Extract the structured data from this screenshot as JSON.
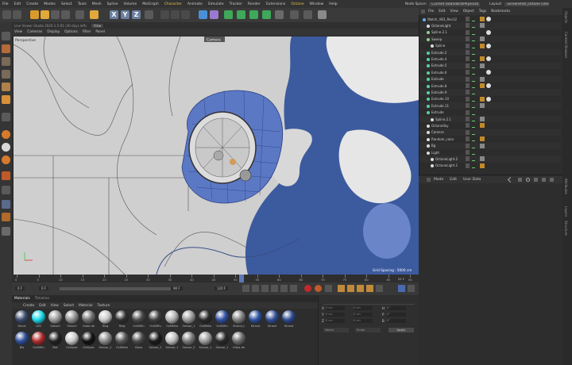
{
  "menubar": {
    "items": [
      "File",
      "Edit",
      "Create",
      "Modes",
      "Select",
      "Tools",
      "Mesh",
      "Spline",
      "Volume",
      "MoGraph",
      "Character",
      "Animate",
      "Simulate",
      "Tracker",
      "Render",
      "Extensions",
      "Octane",
      "Window",
      "Help"
    ],
    "highlighted": [
      "Character",
      "Octane"
    ]
  },
  "topright": {
    "node_space_label": "Node Space:",
    "node_space_value": "Current (Standard/Physical)",
    "layout_label": "Layout:",
    "layout_value": "Screenshot_Octane (User)"
  },
  "toolbar": {
    "axis_x": "X",
    "axis_y": "Y",
    "axis_z": "Z"
  },
  "viewport": {
    "title": "Live Viewer Studio 2020.1.5-R1 (30 days left)",
    "title_tab": "View",
    "menu": [
      "View",
      "Cameras",
      "Display",
      "Options",
      "Filter",
      "Panel"
    ],
    "label": "Perspective",
    "camera": "Camera",
    "grid_spacing": "Grid Spacing : 5000 cm"
  },
  "timeline": {
    "ticks": [
      "0",
      "5",
      "10",
      "15",
      "20",
      "25",
      "30",
      "35",
      "40",
      "45",
      "50",
      "55",
      "60",
      "65",
      "70",
      "75",
      "80",
      "85",
      "90"
    ],
    "current_frame": "51 F",
    "start_field": "0 F",
    "start_field2": "0 F",
    "end_field": "90 F",
    "end_field2": "120 F"
  },
  "materials": {
    "tabs": [
      "Materials",
      "Timeline"
    ],
    "menu": [
      "Create",
      "Edit",
      "View",
      "Select",
      "Material",
      "Texture"
    ],
    "row1": [
      {
        "label": "Decal",
        "color": "#3a4a6a"
      },
      {
        "label": "LED",
        "color": "#19d6e6"
      },
      {
        "label": "GlassO",
        "color": "#9a9a9a"
      },
      {
        "label": "GlassO",
        "color": "#8f8f8f"
      },
      {
        "label": "Glass de",
        "color": "#6e6e6e"
      },
      {
        "label": "Ring",
        "color": "#c8c8c8"
      },
      {
        "label": "Ring",
        "color": "#303030"
      },
      {
        "label": "OctDiffu",
        "color": "#4a4a4a"
      },
      {
        "label": "OctDiffu",
        "color": "#3f3f3f"
      },
      {
        "label": "OctMeta",
        "color": "#b0b0b0"
      },
      {
        "label": "Sensor_1",
        "color": "#999"
      },
      {
        "label": "OctMeta",
        "color": "#2a2a2a"
      },
      {
        "label": "OctDiffu",
        "color": "#2f4fa0"
      },
      {
        "label": "Strand_t",
        "color": "#7f7f7f"
      },
      {
        "label": "Strand",
        "color": "#2b4f9f"
      },
      {
        "label": "Strand",
        "color": "#324f95"
      },
      {
        "label": "Strand",
        "color": "#2d4a8f"
      }
    ],
    "row2": [
      {
        "label": "Bio",
        "color": "#2e4d99"
      },
      {
        "label": "OctDiffu",
        "color": "#b02a2a"
      },
      {
        "label": "Mat",
        "color": "#222"
      },
      {
        "label": "OctSpec",
        "color": "#c8c8c8"
      },
      {
        "label": "OctSpec",
        "color": "#111"
      },
      {
        "label": "Sensor_1",
        "color": "#888"
      },
      {
        "label": "OctMeta",
        "color": "#555"
      },
      {
        "label": "Glass",
        "color": "#4a4a4a"
      },
      {
        "label": "Sensor_1",
        "color": "#1a1a1a"
      },
      {
        "label": "Sensor_1",
        "color": "#bdbdbd"
      },
      {
        "label": "Sensor_2",
        "color": "#777"
      },
      {
        "label": "Sensor_1",
        "color": "#9a9a9a"
      },
      {
        "label": "Sensor_1",
        "color": "#2a2a2a"
      },
      {
        "label": "Glass de",
        "color": "#6a6a6a"
      }
    ]
  },
  "coords": {
    "x": "X",
    "y": "Y",
    "z": "Z",
    "h": "H",
    "p": "P",
    "b": "B",
    "x_val": "0 cm",
    "y_val": "0 cm",
    "z_val": "0 cm",
    "h_val": "0°",
    "p_val": "0°",
    "b_val": "0°",
    "size_x": "0 cm",
    "size_y": "0 cm",
    "size_z": "0 cm",
    "mode1": "World",
    "mode2": "Scale",
    "apply": "Apply"
  },
  "objects": {
    "menu": [
      "File",
      "Edit",
      "View",
      "Object",
      "Tags",
      "Bookmarks"
    ],
    "items": [
      {
        "name": "Watch_VB3_Rev12",
        "indent": 0,
        "color": "#6ab0ff"
      },
      {
        "name": "OctaneLight",
        "indent": 1,
        "color": "#ddd"
      },
      {
        "name": "Spline.2.1",
        "indent": 1,
        "color": "#8fd18f"
      },
      {
        "name": "Sweep",
        "indent": 1,
        "color": "#8fd18f"
      },
      {
        "name": "Spline",
        "indent": 2,
        "color": "#ddd"
      },
      {
        "name": "Extrude.2",
        "indent": 1,
        "color": "#5ad3a0"
      },
      {
        "name": "Extrude.4",
        "indent": 1,
        "color": "#5ad3a0"
      },
      {
        "name": "Extrude.5",
        "indent": 1,
        "color": "#5ad3a0"
      },
      {
        "name": "Extrude.6",
        "indent": 1,
        "color": "#5ad3a0"
      },
      {
        "name": "Extrude",
        "indent": 1,
        "color": "#5ad3a0"
      },
      {
        "name": "Extrude.8",
        "indent": 1,
        "color": "#5ad3a0"
      },
      {
        "name": "Extrude.9",
        "indent": 1,
        "color": "#5ad3a0"
      },
      {
        "name": "Extrude.10",
        "indent": 1,
        "color": "#5ad3a0"
      },
      {
        "name": "Extrude.11",
        "indent": 1,
        "color": "#5ad3a0"
      },
      {
        "name": "Extrude",
        "indent": 1,
        "color": "#5ad3a0"
      },
      {
        "name": "Spline.2.1",
        "indent": 2,
        "color": "#ddd"
      },
      {
        "name": "OctaneSky",
        "indent": 1,
        "color": "#ddd"
      },
      {
        "name": "Camera",
        "indent": 1,
        "color": "#ddd"
      },
      {
        "name": "Random_color",
        "indent": 1,
        "color": "#ddd"
      },
      {
        "name": "Bg",
        "indent": 1,
        "color": "#ddd"
      },
      {
        "name": "Light",
        "indent": 1,
        "color": "#ddd"
      },
      {
        "name": "OctaneLight.2",
        "indent": 2,
        "color": "#ddd"
      },
      {
        "name": "OctaneLight.1",
        "indent": 2,
        "color": "#ddd"
      }
    ]
  },
  "attributes": {
    "menu": [
      "Mode",
      "Edit",
      "User Data"
    ]
  },
  "sidetabs": [
    "Objects",
    "Content Browser",
    "Attributes",
    "Layers",
    "Structure"
  ]
}
